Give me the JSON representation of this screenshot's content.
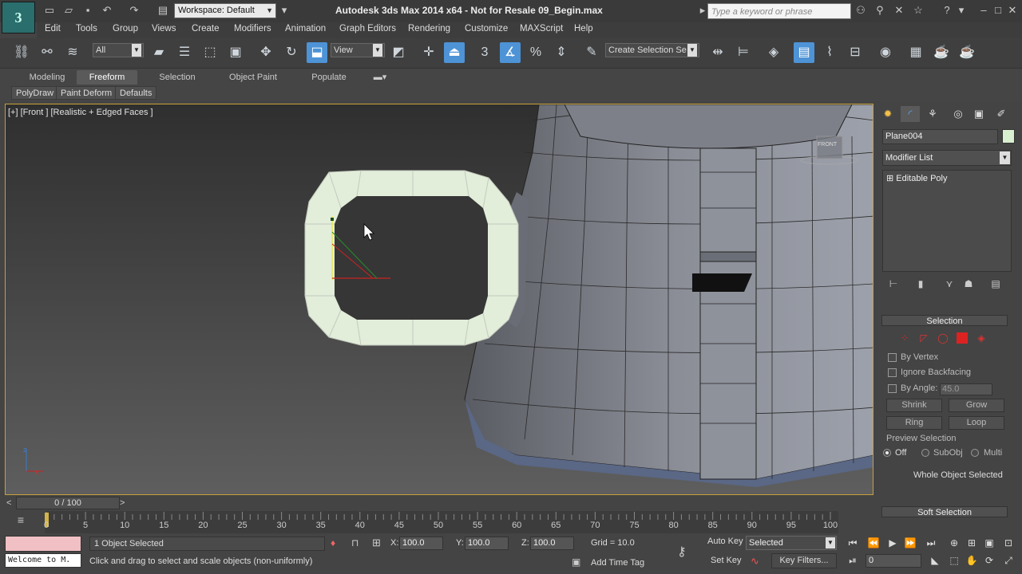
{
  "app": {
    "title": "Autodesk 3ds Max  2014 x64  - Not for Resale   09_Begin.max",
    "logo": "3",
    "workspace": "Workspace: Default",
    "search_placeholder": "Type a keyword or phrase"
  },
  "menu": [
    "Edit",
    "Tools",
    "Group",
    "Views",
    "Create",
    "Modifiers",
    "Animation",
    "Graph Editors",
    "Rendering",
    "Customize",
    "MAXScript",
    "Help"
  ],
  "toolbar": {
    "filter": "All",
    "ref_coord": "View",
    "snap_3": "3",
    "selection_set": "Create Selection Se"
  },
  "ribbon": {
    "tabs": [
      "Modeling",
      "Freeform",
      "Selection",
      "Object Paint",
      "Populate"
    ],
    "active_tab": "Freeform",
    "buttons": [
      "PolyDraw",
      "Paint Deform",
      "Defaults"
    ]
  },
  "viewport": {
    "label": "[+] [Front ] [Realistic + Edged Faces ]",
    "viewcube": "FRONT",
    "axis_x": "x",
    "axis_z": "z"
  },
  "command_panel": {
    "object_name": "Plane004",
    "modifier_list": "Modifier List",
    "stack_item": "Editable Poly",
    "selection_rollout": "Selection",
    "rollout_toggle_minus": "-",
    "by_vertex": "By Vertex",
    "ignore_backfacing": "Ignore Backfacing",
    "by_angle": "By Angle:",
    "angle_value": "45.0",
    "shrink": "Shrink",
    "grow": "Grow",
    "ring": "Ring",
    "loop": "Loop",
    "preview_selection": "Preview Selection",
    "off": "Off",
    "subobj": "SubObj",
    "multi": "Multi",
    "whole_object": "Whole Object Selected",
    "soft_selection": "Soft Selection",
    "rollout_toggle_plus": "+"
  },
  "timeline": {
    "slider": "0 / 100",
    "ticks": [
      "0",
      "5",
      "10",
      "15",
      "20",
      "25",
      "30",
      "35",
      "40",
      "45",
      "50",
      "55",
      "60",
      "65",
      "70",
      "75",
      "80",
      "85",
      "90",
      "95",
      "100"
    ]
  },
  "status": {
    "welcome": "Welcome to M.",
    "objects_selected": "1 Object Selected",
    "prompt": "Click and drag to select and scale objects (non-uniformly)",
    "x_label": "X:",
    "y_label": "Y:",
    "z_label": "Z:",
    "x": "100.0",
    "y": "100.0",
    "z": "100.0",
    "grid": "Grid = 10.0",
    "add_time_tag": "Add Time Tag",
    "auto_key": "Auto Key",
    "set_key": "Set Key",
    "key_mode": "Selected",
    "key_filters": "Key Filters...",
    "frame": "0"
  }
}
